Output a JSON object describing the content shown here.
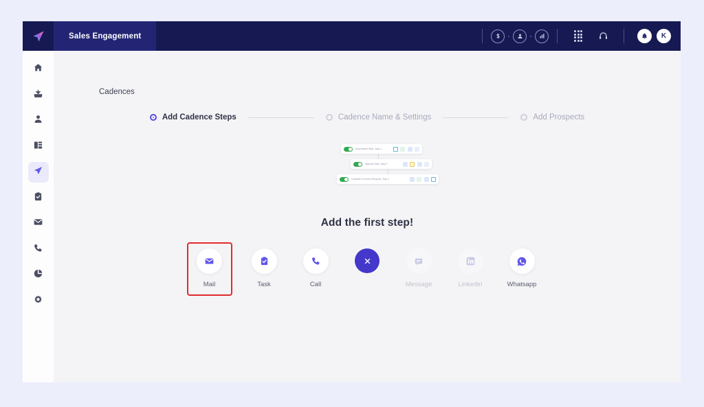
{
  "colors": {
    "page_background": "#eceefc",
    "header_navy": "#171a52",
    "header_tab_navy": "#232574",
    "accent_purple": "#6157e8",
    "active_step_purple": "#5b4ee0",
    "close_button_blue": "#4338ca",
    "highlight_red": "#e02a2a",
    "toggle_green": "#35a853",
    "content_background": "#f4f4f6",
    "sidebar_background": "#fdfdfe"
  },
  "header": {
    "brand_icon": "paper-plane-logo-icon",
    "app_tab_label": "Sales Engagement",
    "right_icons": [
      {
        "name": "dollar-circle-icon",
        "glyph": "$"
      },
      {
        "name": "user-circle-icon",
        "glyph": "●"
      },
      {
        "name": "analytics-circle-icon",
        "glyph": "■"
      },
      {
        "name": "dialpad-icon",
        "glyph": ""
      },
      {
        "name": "headset-icon",
        "glyph": ""
      }
    ],
    "notification_icon": "bell-icon",
    "avatar_initial": "K"
  },
  "sidebar": {
    "items": [
      {
        "name": "sidebar-item-home",
        "icon": "home-icon",
        "active": false
      },
      {
        "name": "sidebar-item-inbox",
        "icon": "inbox-icon",
        "active": false
      },
      {
        "name": "sidebar-item-contacts",
        "icon": "person-icon",
        "active": false
      },
      {
        "name": "sidebar-item-accounts",
        "icon": "building-list-icon",
        "active": false
      },
      {
        "name": "sidebar-item-cadences",
        "icon": "paper-plane-icon",
        "active": true
      },
      {
        "name": "sidebar-item-tasks",
        "icon": "clipboard-check-icon",
        "active": false
      },
      {
        "name": "sidebar-item-mail",
        "icon": "envelope-icon",
        "active": false
      },
      {
        "name": "sidebar-item-calls",
        "icon": "phone-icon",
        "active": false
      },
      {
        "name": "sidebar-item-reports",
        "icon": "pie-chart-icon",
        "active": false
      },
      {
        "name": "sidebar-item-settings",
        "icon": "gear-icon",
        "active": false
      }
    ]
  },
  "main": {
    "page_title": "Cadences",
    "stepper": {
      "steps": [
        {
          "label": "Add Cadence Steps",
          "active": true
        },
        {
          "label": "Cadence Name & Settings",
          "active": false
        },
        {
          "label": "Add Prospects",
          "active": false
        }
      ]
    },
    "illustration": {
      "cards": [
        {
          "label": "Automated Step, Day 1"
        },
        {
          "label": "Manual Step, Day 2"
        },
        {
          "label": "LinkedIn Connect Request, Day 3"
        }
      ]
    },
    "headline": "Add the first step!",
    "options": [
      {
        "label": "Mail",
        "icon": "envelope-icon",
        "disabled": false,
        "highlighted": true,
        "type": "option"
      },
      {
        "label": "Task",
        "icon": "clipboard-check-icon",
        "disabled": false,
        "highlighted": false,
        "type": "option"
      },
      {
        "label": "Call",
        "icon": "phone-icon",
        "disabled": false,
        "highlighted": false,
        "type": "option"
      },
      {
        "label": "",
        "icon": "close-icon",
        "disabled": false,
        "highlighted": false,
        "type": "close"
      },
      {
        "label": "Message",
        "icon": "chat-bubble-icon",
        "disabled": true,
        "highlighted": false,
        "type": "option"
      },
      {
        "label": "Linkedin",
        "icon": "linkedin-icon",
        "disabled": true,
        "highlighted": false,
        "type": "option"
      },
      {
        "label": "Whatsapp",
        "icon": "whatsapp-icon",
        "disabled": false,
        "highlighted": false,
        "type": "option"
      }
    ]
  }
}
